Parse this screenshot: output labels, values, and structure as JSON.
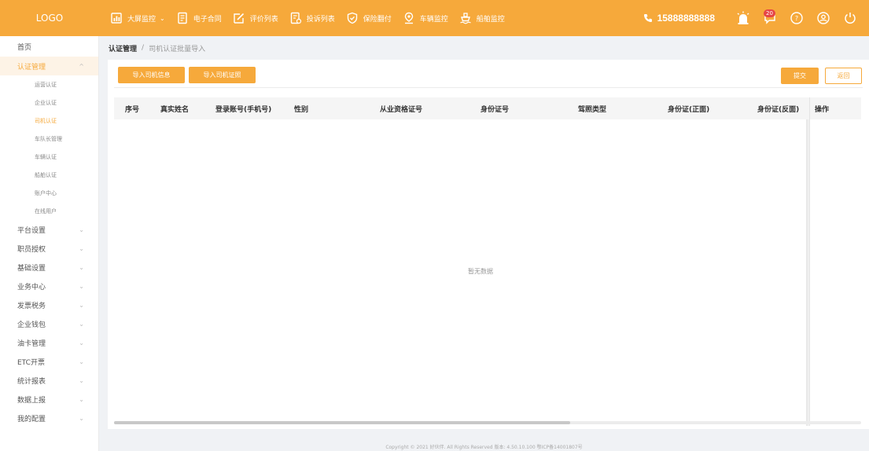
{
  "header": {
    "logo": "LOGO",
    "nav": [
      {
        "label": "大屏监控",
        "icon": "dashboard-icon",
        "caret": "⌄"
      },
      {
        "label": "电子合同",
        "icon": "contract-icon"
      },
      {
        "label": "评价列表",
        "icon": "edit-icon"
      },
      {
        "label": "投诉列表",
        "icon": "complaint-icon"
      },
      {
        "label": "保险翻付",
        "icon": "shield-check-icon"
      },
      {
        "label": "车辆监控",
        "icon": "location-pin-icon"
      },
      {
        "label": "船舶监控",
        "icon": "ship-icon"
      }
    ],
    "phone": "15888888888",
    "message_count": "20",
    "accent": "#f6a93b"
  },
  "sidebar": {
    "home": "首页",
    "auth_group": "认证管理",
    "auth_sub": [
      "运营认证",
      "企业认证",
      "司机认证",
      "车队长管理",
      "车辆认证",
      "船舶认证",
      "账户中心",
      "在线用户"
    ],
    "groups": [
      "平台设置",
      "职员授权",
      "基础设置",
      "业务中心",
      "发票税务",
      "企业钱包",
      "油卡管理",
      "ETC开票",
      "统计报表",
      "数据上报",
      "我的配置"
    ]
  },
  "breadcrumb": {
    "first": "认证管理",
    "separator": "/",
    "current": "司机认证批量导入"
  },
  "toolbar": {
    "import_info": "导入司机信息",
    "import_cert": "导入司机证照",
    "submit": "提交",
    "back": "返回"
  },
  "table": {
    "columns": [
      "序号",
      "真实姓名",
      "登录账号(手机号)",
      "性别",
      "从业资格证号",
      "身份证号",
      "驾照类型",
      "身份证(正面)",
      "身份证(反面)",
      "操作"
    ],
    "empty_text": "暂无数据"
  },
  "footer": {
    "text": "Copyright © 2021 好伙伴. All Rights Reserved   版本: 4.50.10.100 鄂ICP备14001807号"
  }
}
